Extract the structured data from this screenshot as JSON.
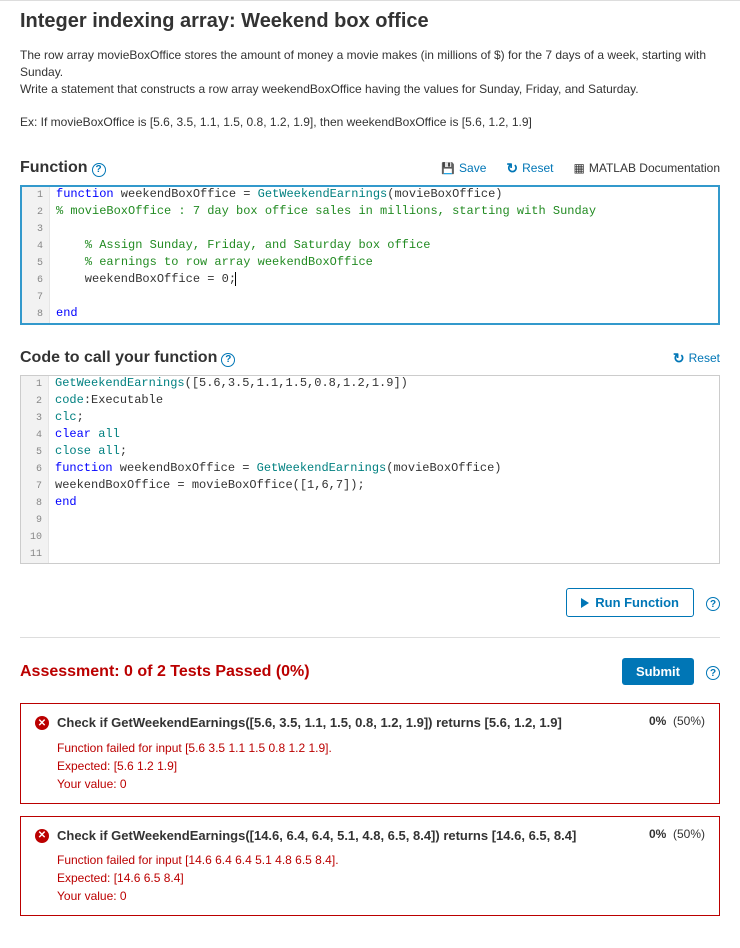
{
  "title": "Integer indexing array: Weekend box office",
  "description_line1": "The row array movieBoxOffice stores the amount of money a movie makes (in millions of $) for the 7 days of a week, starting with Sunday.",
  "description_line2": "Write a statement that constructs a row array weekendBoxOffice having the values for Sunday, Friday, and Saturday.",
  "example": "Ex: If movieBoxOffice is [5.6, 3.5, 1.1, 1.5, 0.8, 1.2, 1.9], then weekendBoxOffice is [5.6, 1.2, 1.9]",
  "section_function": "Function",
  "toolbar": {
    "save": "Save",
    "reset": "Reset",
    "docs": "MATLAB Documentation"
  },
  "editor1_lines": [
    {
      "n": "1",
      "pre": "",
      "blue": "function",
      "post": " weekendBoxOffice = ",
      "teal": "GetWeekendEarnings",
      "rest": "(movieBoxOffice)"
    },
    {
      "n": "2",
      "comment": "% movieBoxOffice : 7 day box office sales in millions, starting with Sunday"
    },
    {
      "n": "3",
      "plain": ""
    },
    {
      "n": "4",
      "indent": "    ",
      "comment": "% Assign Sunday, Friday, and Saturday box office"
    },
    {
      "n": "5",
      "indent": "    ",
      "comment": "% earnings to row array weekendBoxOffice"
    },
    {
      "n": "6",
      "plain": "    weekendBoxOffice = 0;",
      "caret": true
    },
    {
      "n": "7",
      "plain": ""
    },
    {
      "n": "8",
      "blue": "end"
    }
  ],
  "section_call": "Code to call your function",
  "reset2": "Reset",
  "editor2_lines": [
    {
      "n": "1",
      "teal": "GetWeekendEarnings",
      "rest": "([5.6,3.5,1.1,1.5,0.8,1.2,1.9])"
    },
    {
      "n": "2",
      "plain": "Executable ",
      "teal2": "code",
      "rest2": ":"
    },
    {
      "n": "3",
      "teal": "clc",
      "rest": ";"
    },
    {
      "n": "4",
      "blue": "clear ",
      "teal2": "all"
    },
    {
      "n": "5",
      "teal": "close ",
      "teal2": "all",
      "rest2": ";"
    },
    {
      "n": "6",
      "blue": "function",
      "post": " weekendBoxOffice = ",
      "teal": "GetWeekendEarnings",
      "rest": "(movieBoxOffice)"
    },
    {
      "n": "7",
      "plain": "weekendBoxOffice = movieBoxOffice([1,6,7]);"
    },
    {
      "n": "8",
      "blue": "end"
    },
    {
      "n": "9",
      "plain": ""
    },
    {
      "n": "10",
      "plain": ""
    },
    {
      "n": "11",
      "plain": ""
    }
  ],
  "run_btn": "Run Function",
  "assessment_title": "Assessment: 0 of 2 Tests Passed (0%)",
  "submit": "Submit",
  "tests": [
    {
      "name": "Check if GetWeekendEarnings([5.6, 3.5, 1.1, 1.5, 0.8, 1.2, 1.9]) returns [5.6, 1.2, 1.9]",
      "score": "0%",
      "weight": "(50%)",
      "d1": "Function failed for input [5.6 3.5 1.1 1.5 0.8 1.2 1.9].",
      "d2": "Expected: [5.6 1.2 1.9]",
      "d3": "Your value: 0"
    },
    {
      "name": "Check if GetWeekendEarnings([14.6, 6.4, 6.4, 5.1, 4.8, 6.5, 8.4]) returns [14.6, 6.5, 8.4]",
      "score": "0%",
      "weight": "(50%)",
      "d1": "Function failed for input [14.6 6.4 6.4 5.1 4.8 6.5 8.4].",
      "d2": "Expected: [14.6 6.5 8.4]",
      "d3": "Your value: 0"
    }
  ]
}
